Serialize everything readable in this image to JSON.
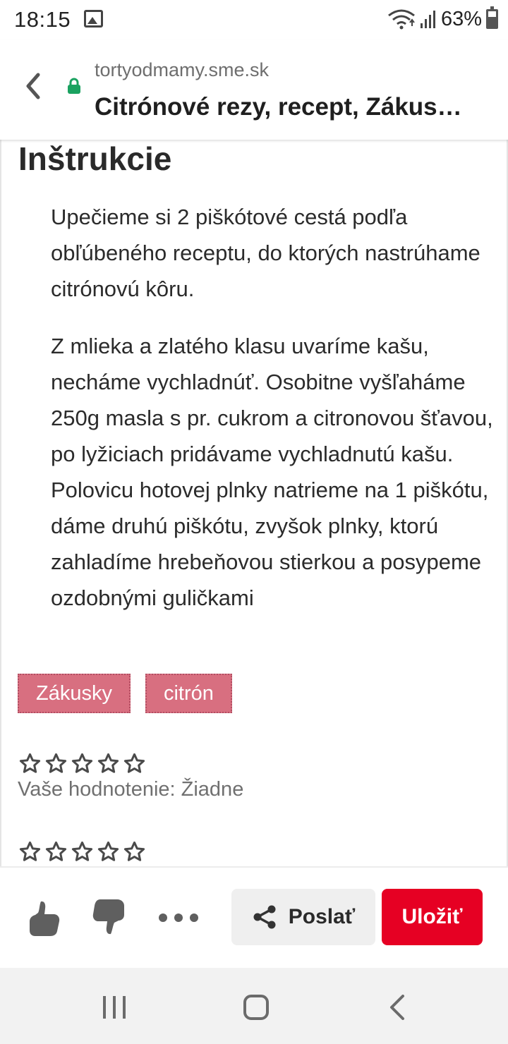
{
  "status_bar": {
    "time": "18:15",
    "battery": "63%",
    "battery_level": 0.63,
    "icons": [
      "image-icon",
      "wifi-icon",
      "signal-icon",
      "battery-icon"
    ]
  },
  "url_bar": {
    "domain": "tortyodmamy.sme.sk",
    "title": "Citrónové rezy, recept, Zákus…"
  },
  "content": {
    "heading": "Inštrukcie",
    "paragraphs": [
      "Upečieme si 2 piškótové cestá podľa obľúbeného receptu, do ktorých nastrúhame citrónovú kôru.",
      "Z mlieka a zlatého klasu uvaríme kašu, necháme vychladnúť. Osobitne vyšľaháme 250g masla s pr. cukrom a citronovou šťavou, po lyžiciach pridávame vychladnutú kašu. Polovicu hotovej plnky natrieme na 1 piškótu, dáme druhú piškótu, zvyšok plnky, ktorú zahladíme hrebeňovou stierkou a posypeme ozdobnými guličkami"
    ],
    "tags": [
      "Zákusky",
      "citrón"
    ],
    "rating_label": "Vaše hodnotenie: Žiadne",
    "user_rating": 0,
    "max_rating": 5
  },
  "actions": {
    "share_label": "Poslať",
    "save_label": "Uložiť"
  },
  "colors": {
    "tag_bg": "#d86f80",
    "save_red": "#e60023",
    "lock_green": "#1aa260"
  }
}
